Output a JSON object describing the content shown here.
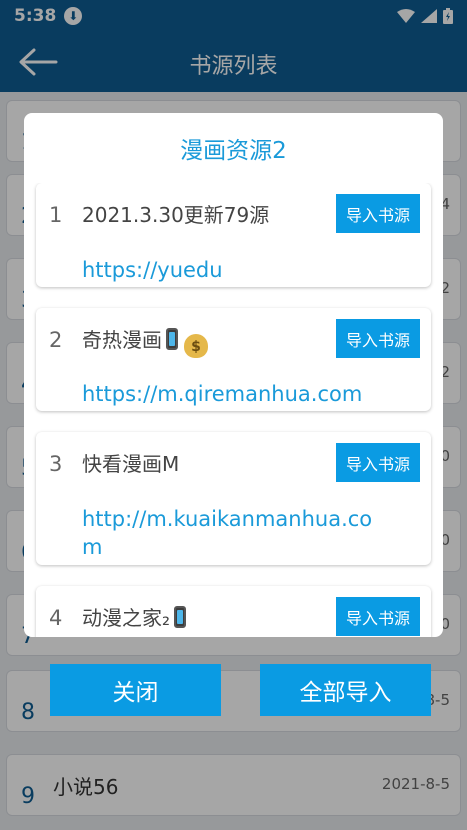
{
  "status": {
    "time": "5:38"
  },
  "appbar": {
    "title": "书源列表"
  },
  "bg_list": [
    {
      "num": "1",
      "name": "",
      "date": "",
      "top": 0
    },
    {
      "num": "2",
      "name": "",
      "date": "4",
      "top": 0
    },
    {
      "num": "3",
      "name": "",
      "date": "2",
      "top": 0
    },
    {
      "num": "4",
      "name": "",
      "date": "2",
      "top": 0
    },
    {
      "num": "5",
      "name": "",
      "date": "0",
      "top": 0
    },
    {
      "num": "6",
      "name": "",
      "date": "0",
      "top": 0
    },
    {
      "num": "7",
      "name": "",
      "date": "0",
      "top": 0
    },
    {
      "num": "8",
      "name": "",
      "date": "8-5",
      "top": 0
    },
    {
      "num": "9",
      "name": "小说56",
      "date": "2021-8-5",
      "top": 0
    }
  ],
  "dialog": {
    "title": "漫画资源2",
    "import_label": "导入书源",
    "sources": [
      {
        "index": "1",
        "name": "2021.3.30更新79源",
        "url": "https://yuedu"
      },
      {
        "index": "2",
        "name": "奇热漫画",
        "url": "https://m.qiremanhua.com"
      },
      {
        "index": "3",
        "name": "快看漫画M",
        "url": "http://m.kuaikanmanhua.com"
      },
      {
        "index": "4",
        "name": "动漫之家₂",
        "url": ""
      }
    ],
    "close_label": "关闭",
    "import_all_label": "全部导入"
  }
}
